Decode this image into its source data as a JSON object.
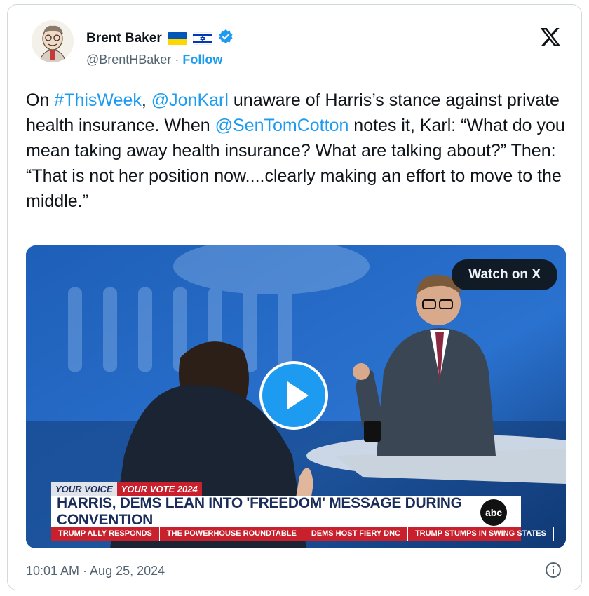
{
  "author": {
    "name": "Brent Baker",
    "handle": "@BrentHBaker",
    "separator": "·",
    "follow_label": "Follow",
    "avatar_icon": "caricature-avatar",
    "badges": [
      "ukraine-flag-icon",
      "israel-flag-icon",
      "verified-badge-icon"
    ]
  },
  "tweet": {
    "segments": [
      {
        "text": "On ",
        "link": false
      },
      {
        "text": "#ThisWeek",
        "link": true
      },
      {
        "text": ", ",
        "link": false
      },
      {
        "text": "@JonKarl",
        "link": true
      },
      {
        "text": " unaware of Harris’s stance against private health insurance. When ",
        "link": false
      },
      {
        "text": "@SenTomCotton",
        "link": true
      },
      {
        "text": " notes it, Karl: “What do you mean taking away health insurance? What are talking about?” Then: “That is not her position now....clearly making an effort to move to the middle.”",
        "link": false
      }
    ]
  },
  "video": {
    "watch_label": "Watch on X",
    "play_icon": "play-icon",
    "lower_third": {
      "tag_left": "YOUR VOICE",
      "tag_right": "YOUR VOTE 2024",
      "headline": "HARRIS, DEMS LEAN INTO 'FREEDOM' MESSAGE DURING CONVENTION",
      "network": "abc",
      "ticker": [
        "TRUMP ALLY RESPONDS",
        "THE POWERHOUSE ROUNDTABLE",
        "DEMS HOST FIERY DNC",
        "TRUMP STUMPS IN SWING STATES"
      ]
    }
  },
  "footer": {
    "timestamp": "10:01 AM · Aug 25, 2024",
    "info_icon": "info-icon"
  },
  "colors": {
    "link": "#1d9bf0",
    "text": "#0f1419",
    "muted": "#536471",
    "border": "#cfd9de",
    "abc_red": "#c8202c",
    "abc_navy": "#1a2d5a"
  }
}
